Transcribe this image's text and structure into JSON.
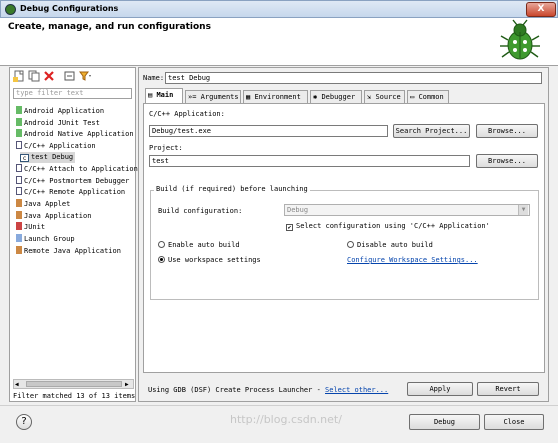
{
  "window": {
    "title": "Debug Configurations",
    "close_label": "X"
  },
  "header": {
    "title": "Create, manage, and run configurations"
  },
  "toolbar": {
    "icons": [
      "new-config-icon",
      "duplicate-icon",
      "delete-icon",
      "collapse-all-icon",
      "filter-icon"
    ]
  },
  "filter": {
    "placeholder": "type filter text"
  },
  "tree": {
    "items": [
      {
        "label": "Android Application"
      },
      {
        "label": "Android JUnit Test"
      },
      {
        "label": "Android Native Application"
      },
      {
        "label": "C/C++ Application"
      },
      {
        "label": "test Debug"
      },
      {
        "label": "C/C++ Attach to Application"
      },
      {
        "label": "C/C++ Postmortem Debugger"
      },
      {
        "label": "C/C++ Remote Application"
      },
      {
        "label": "Java Applet"
      },
      {
        "label": "Java Application"
      },
      {
        "label": "JUnit"
      },
      {
        "label": "Launch Group"
      },
      {
        "label": "Remote Java Application"
      }
    ],
    "status": "Filter matched 13 of 13 items"
  },
  "config": {
    "name_label": "Name:",
    "name_value": "test Debug",
    "tabs": [
      {
        "label": "Main"
      },
      {
        "label": "Arguments"
      },
      {
        "label": "Environment"
      },
      {
        "label": "Debugger"
      },
      {
        "label": "Source"
      },
      {
        "label": "Common"
      }
    ],
    "app_label": "C/C++ Application:",
    "app_value": "Debug/test.exe",
    "search_project_label": "Search Project...",
    "browse_label": "Browse...",
    "project_label": "Project:",
    "project_value": "test",
    "group_title": "Build (if required) before launching",
    "build_config_label": "Build configuration:",
    "build_config_value": "Debug",
    "select_config_label": "Select configuration using 'C/C++ Application'",
    "enable_auto_build": "Enable auto build",
    "disable_auto_build": "Disable auto build",
    "use_workspace": "Use workspace settings",
    "configure_workspace": "Configure Workspace Settings...",
    "launcher_text": "Using GDB (DSF) Create Process Launcher - ",
    "select_other": "Select other...",
    "apply_label": "Apply",
    "revert_label": "Revert"
  },
  "footer": {
    "help_label": "?",
    "debug_label": "Debug",
    "close_label": "Close",
    "watermark": "http://blog.csdn.net/"
  },
  "colors": {
    "accent": "#0645ad",
    "title_bar": "#c6d7ec",
    "close_red": "#c9462d"
  }
}
